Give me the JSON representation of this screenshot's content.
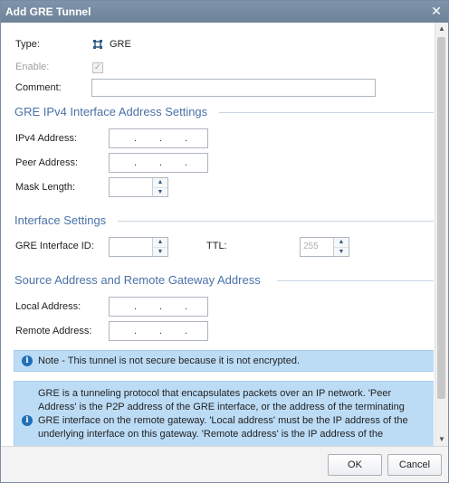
{
  "window": {
    "title": "Add GRE Tunnel"
  },
  "general": {
    "type_label": "Type:",
    "type_value": "GRE",
    "enable_label": "Enable:",
    "enable_checked": true,
    "comment_label": "Comment:",
    "comment_value": ""
  },
  "sections": {
    "ipv4": "GRE IPv4 Interface Address Settings",
    "interface": "Interface Settings",
    "source": "Source Address and Remote Gateway Address"
  },
  "ipv4": {
    "ipv4_address_label": "IPv4 Address:",
    "peer_address_label": "Peer Address:",
    "mask_length_label": "Mask Length:",
    "mask_length_value": ""
  },
  "interface": {
    "gre_interface_id_label": "GRE Interface ID:",
    "gre_interface_id_value": "",
    "ttl_label": "TTL:",
    "ttl_value": "255"
  },
  "source": {
    "local_address_label": "Local Address:",
    "remote_address_label": "Remote Address:"
  },
  "notes": {
    "warning": "Note - This tunnel is not secure because it is not encrypted.",
    "info_lines": [
      "GRE is a tunneling protocol that encapsulates packets over an IP network. 'Peer",
      "Address' is the P2P address of the GRE interface, or the address of the terminating",
      "GRE interface on the remote gateway. 'Local address' must be the IP address of the",
      "underlying interface on this gateway. 'Remote address' is the IP address of the"
    ]
  },
  "footer": {
    "ok_label": "OK",
    "cancel_label": "Cancel"
  },
  "colors": {
    "titlebar": "#7589a0",
    "section_heading": "#4a72a8",
    "note_background": "#bcdcf6",
    "info_icon": "#1f6fb7"
  },
  "icons": {
    "type_icon": "gre-tunnel-icon",
    "info": "info-icon",
    "close": "close-icon"
  }
}
